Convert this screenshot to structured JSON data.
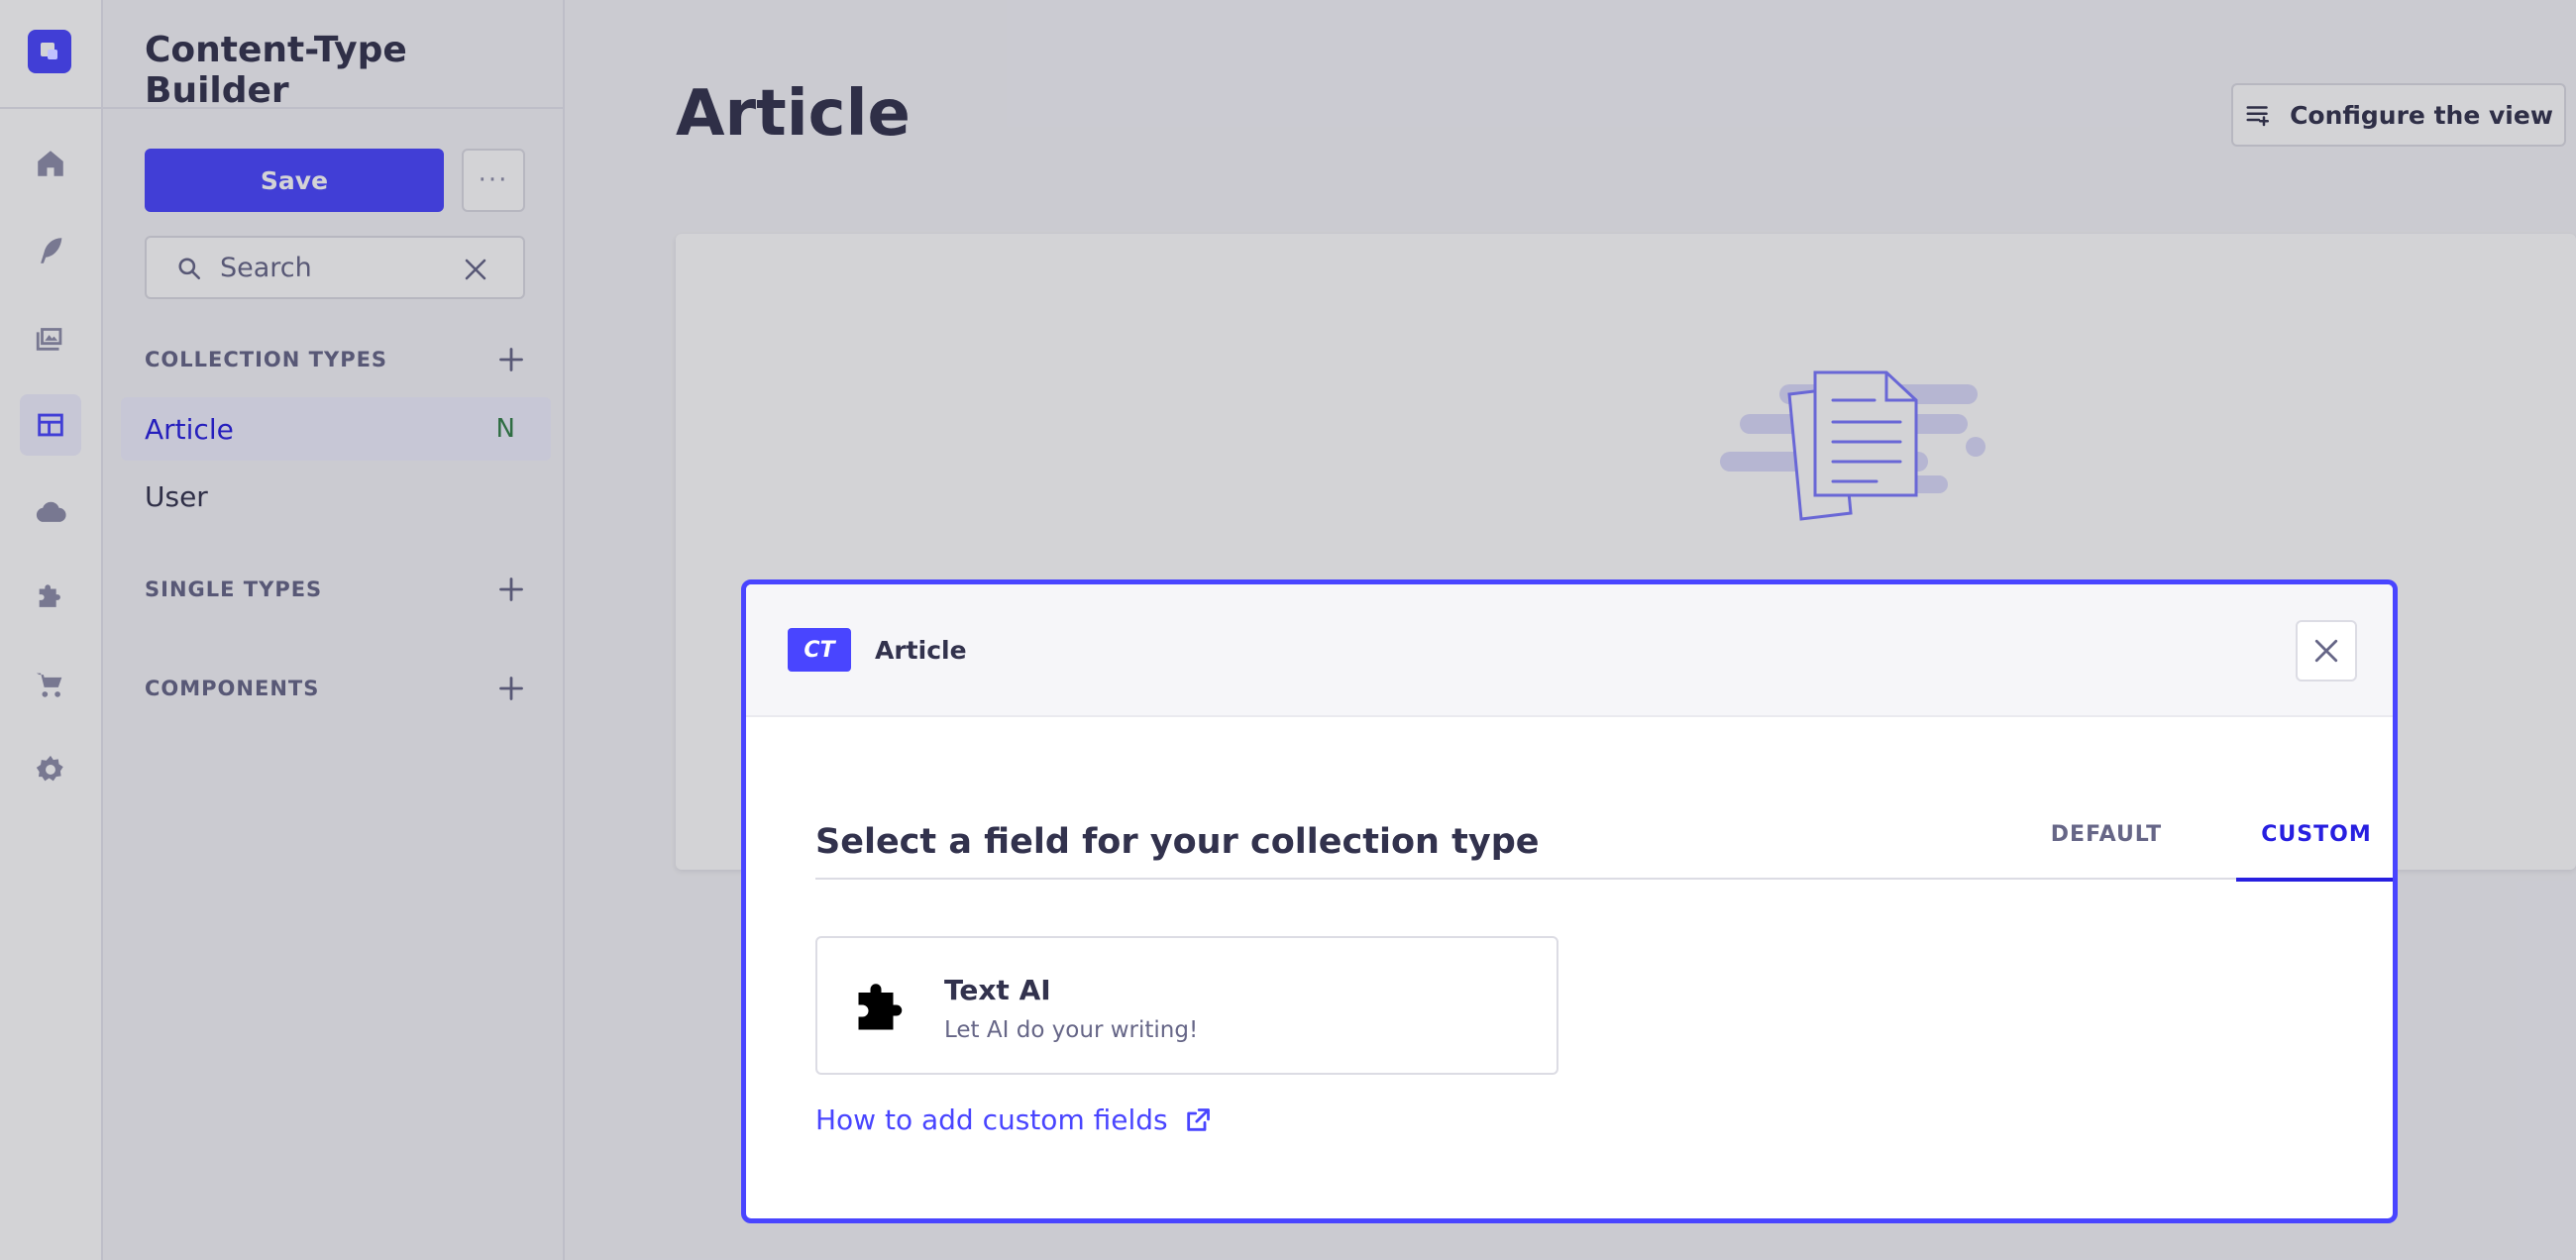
{
  "sidebar_rail": {
    "items": [
      {
        "name": "home-icon"
      },
      {
        "name": "feather-icon"
      },
      {
        "name": "media-library-icon"
      },
      {
        "name": "layout-icon",
        "active": true
      },
      {
        "name": "cloud-icon"
      },
      {
        "name": "puzzle-icon"
      },
      {
        "name": "cart-icon"
      },
      {
        "name": "cog-icon"
      }
    ]
  },
  "subnav": {
    "title": "Content-Type Builder",
    "save_label": "Save",
    "more_label": "···",
    "search_placeholder": "Search",
    "sections": [
      {
        "label": "COLLECTION TYPES"
      },
      {
        "label": "SINGLE TYPES"
      },
      {
        "label": "COMPONENTS"
      }
    ],
    "collection_items": [
      {
        "label": "Article",
        "badge": "N",
        "active": true
      },
      {
        "label": "User",
        "badge": "",
        "active": false
      }
    ]
  },
  "main": {
    "title": "Article",
    "configure_label": "Configure the view"
  },
  "modal": {
    "badge": "CT",
    "breadcrumb": "Article",
    "heading": "Select a field for your collection type",
    "tabs": [
      {
        "label": "DEFAULT",
        "selected": false
      },
      {
        "label": "CUSTOM",
        "selected": true
      }
    ],
    "field": {
      "title": "Text AI",
      "description": "Let AI do your writing!"
    },
    "help_link": "How to add custom fields"
  },
  "colors": {
    "primary": "#4945ff",
    "active_text": "#271fe0",
    "success": "#328048"
  }
}
